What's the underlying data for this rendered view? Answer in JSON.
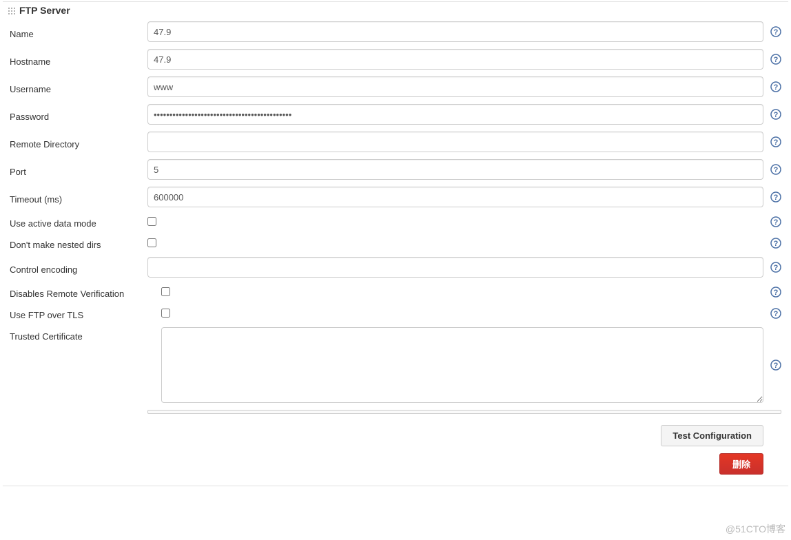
{
  "section": {
    "title": "FTP Server"
  },
  "fields": {
    "name": {
      "label": "Name",
      "value": "47.9",
      "type": "text"
    },
    "hostname": {
      "label": "Hostname",
      "value": "47.9",
      "type": "text"
    },
    "username": {
      "label": "Username",
      "value": "www",
      "type": "text"
    },
    "password": {
      "label": "Password",
      "value": "••••••••••••••••••••••••••••••••••••••••••••",
      "type": "password"
    },
    "remote_dir": {
      "label": "Remote Directory",
      "value": "",
      "type": "text"
    },
    "port": {
      "label": "Port",
      "value": "5",
      "type": "text"
    },
    "timeout": {
      "label": "Timeout (ms)",
      "value": "600000",
      "type": "text"
    },
    "active_mode": {
      "label": "Use active data mode",
      "checked": false,
      "type": "checkbox"
    },
    "no_nested": {
      "label": "Don't make nested dirs",
      "checked": false,
      "type": "checkbox"
    },
    "ctrl_enc": {
      "label": "Control encoding",
      "value": "",
      "type": "text"
    },
    "disable_rv": {
      "label": "Disables Remote Verification",
      "checked": false,
      "type": "checkbox"
    },
    "ftp_tls": {
      "label": "Use FTP over TLS",
      "checked": false,
      "type": "checkbox"
    },
    "trusted_cert": {
      "label": "Trusted Certificate",
      "value": "",
      "type": "textarea"
    }
  },
  "buttons": {
    "test": "Test Configuration",
    "delete": "删除"
  },
  "watermark": "@51CTO博客",
  "help_color": "#4a6fa5"
}
